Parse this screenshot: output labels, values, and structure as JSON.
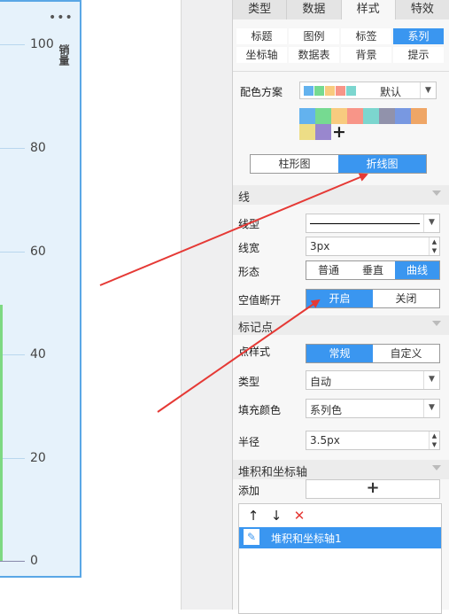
{
  "chart": {
    "more_label": "•••",
    "y_axis_label": "销量",
    "ticks": [
      "100",
      "80",
      "60",
      "40",
      "20",
      "0"
    ]
  },
  "tabs": [
    "类型",
    "数据",
    "样式",
    "特效"
  ],
  "active_tab": "样式",
  "subtabs": [
    "标题",
    "图例",
    "标签",
    "系列",
    "坐标轴",
    "数据表",
    "背景",
    "提示"
  ],
  "active_subtab": "系列",
  "color_scheme": {
    "label": "配色方案",
    "selected": "默认",
    "preview_colors": [
      "#63b2ee",
      "#76da91",
      "#f8cb7f",
      "#f89588",
      "#7cd6cf"
    ],
    "palette": [
      "#63b2ee",
      "#76da91",
      "#f8cb7f",
      "#f89588",
      "#7cd6cf",
      "#9192ab",
      "#7898e1",
      "#efa666",
      "#eddd86",
      "#9987ce"
    ],
    "add_icon": "+"
  },
  "chart_type_toggle": {
    "options": [
      "柱形图",
      "折线图"
    ],
    "active": "折线图"
  },
  "line_section": {
    "title": "线",
    "line_type_label": "线型",
    "line_width_label": "线宽",
    "line_width_value": "3px",
    "shape_label": "形态",
    "shape_options": [
      "普通",
      "垂直",
      "曲线"
    ],
    "shape_active": "曲线",
    "null_break_label": "空值断开",
    "null_break_options": [
      "开启",
      "关闭"
    ],
    "null_break_active": "开启"
  },
  "marker_section": {
    "title": "标记点",
    "style_label": "点样式",
    "style_options": [
      "常规",
      "自定义"
    ],
    "style_active": "常规",
    "type_label": "类型",
    "type_value": "自动",
    "fill_label": "填充颜色",
    "fill_value": "系列色",
    "radius_label": "半径",
    "radius_value": "3.5px"
  },
  "stack_section": {
    "title": "堆积和坐标轴",
    "add_label": "添加",
    "add_icon": "+",
    "tools": [
      "↑",
      "↓",
      "✕"
    ],
    "items": [
      "堆积和坐标轴1"
    ]
  },
  "colors": {
    "accent": "#3a96f0",
    "annotation_arrow": "#e53935",
    "chart_bg": "#e6f2fb",
    "chart_border": "#5aa7e6",
    "series_green": "#7ed982"
  }
}
